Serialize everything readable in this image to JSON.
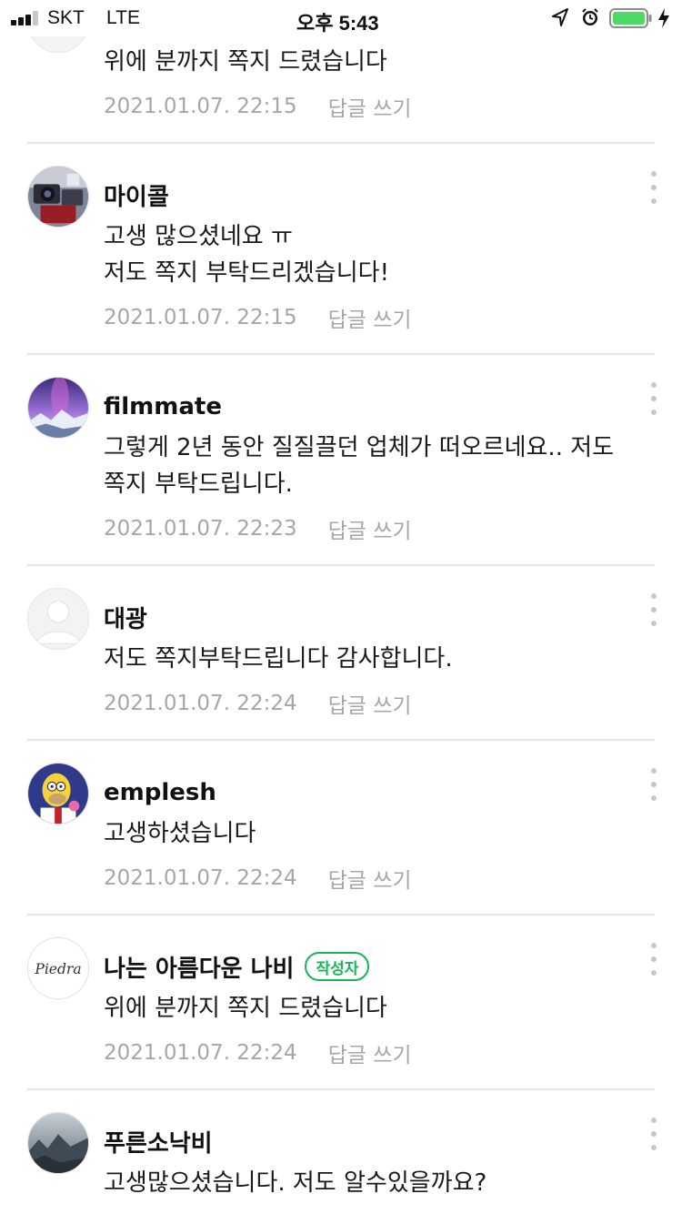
{
  "status_bar": {
    "carrier": "SKT",
    "network": "LTE",
    "time": "오후 5:43",
    "battery_color": "#4cd964"
  },
  "author_badge": "작성자",
  "comments": [
    {
      "author": "",
      "text": "위에 분까지 쪽지 드렸습니다",
      "date": "2021.01.07. 22:15",
      "reply": "답글 쓰기",
      "avatar": "partial-avatar"
    },
    {
      "author": "마이콜",
      "text": "고생 많으셨네요 ㅠ\n저도 쪽지 부탁드리겠습니다!",
      "date": "2021.01.07. 22:15",
      "reply": "답글 쓰기",
      "avatar": "camera-gear-avatar"
    },
    {
      "author": "filmmate",
      "text": "그렇게 2년 동안 질질끌던 업체가 떠오르네요.. 저도 쪽지 부탁드립니다.",
      "date": "2021.01.07. 22:23",
      "reply": "답글 쓰기",
      "avatar": "galaxy-night-avatar"
    },
    {
      "author": "대광",
      "text": "저도 쪽지부탁드립니다 감사합니다.",
      "date": "2021.01.07. 22:24",
      "reply": "답글 쓰기",
      "avatar": "default-profile-avatar"
    },
    {
      "author": "emplesh",
      "text": "고생하셨습니다",
      "date": "2021.01.07. 22:24",
      "reply": "답글 쓰기",
      "avatar": "cartoon-character-avatar"
    },
    {
      "author": "나는 아름다운 나비",
      "text": "위에 분까지 쪽지 드렸습니다",
      "date": "2021.01.07. 22:24",
      "reply": "답글 쓰기",
      "avatar": "piedra-logo-avatar",
      "avatar_logo_text": "Piedra",
      "is_writer": true
    },
    {
      "author": "푸른소낙비",
      "text": "고생많으셨습니다. 저도 알수있을까요?",
      "date": "",
      "reply": "",
      "avatar": "misty-landscape-avatar"
    }
  ]
}
